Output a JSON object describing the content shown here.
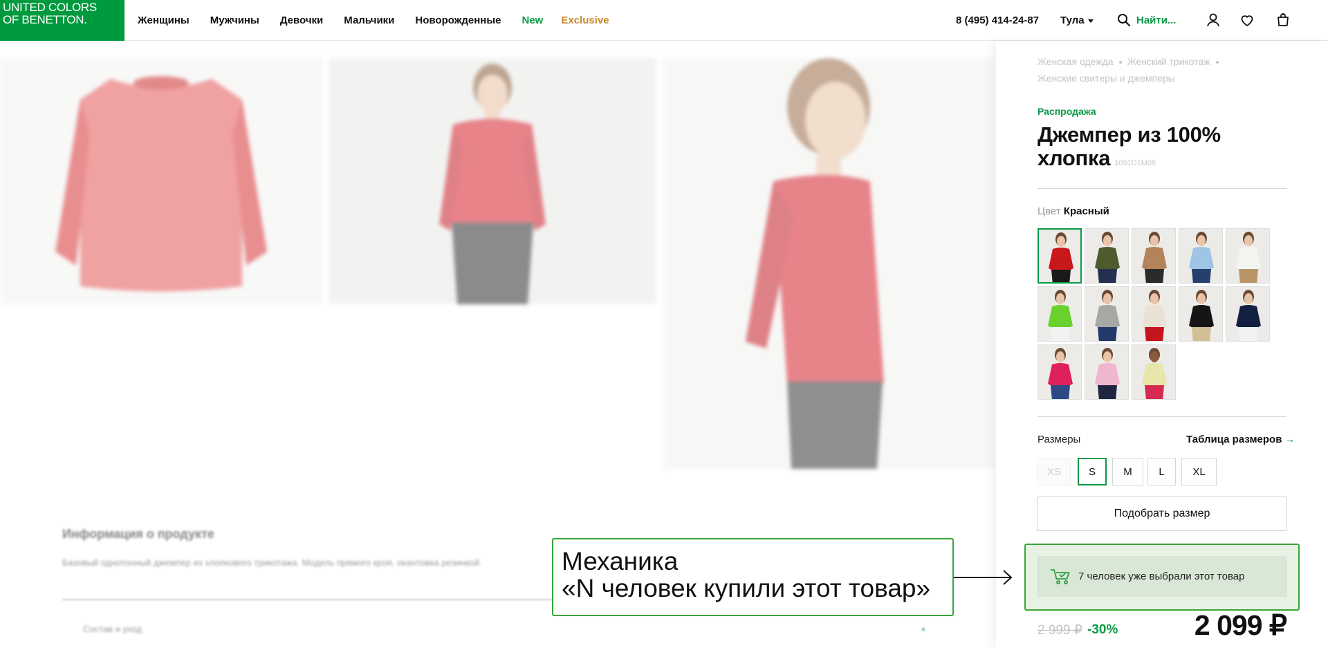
{
  "header": {
    "logo_line1": "UNITED COLORS",
    "logo_line2": "OF BENETTON.",
    "nav": [
      "Женщины",
      "Мужчины",
      "Девочки",
      "Мальчики",
      "Новорожденные",
      "New",
      "Exclusive"
    ],
    "phone": "8 (495) 414-24-87",
    "city": "Тула",
    "search_label": "Найти..."
  },
  "gallery": {
    "info_title": "Информация о продукте",
    "info_text": "Базовый однотонный джемпер из хлопкового трикотажа. Модель прямого кроя, окантовка резинкой.",
    "accordion_label": "Состав и уход"
  },
  "product": {
    "breadcrumbs": [
      "Женская одежда",
      "Женский трикотаж",
      "Женские свитеры и джемперы"
    ],
    "sale_label": "Распродажа",
    "title": "Джемпер из 100% хлопка",
    "sku": "1091D1M08",
    "color_label": "Цвет",
    "color_value": "Красный",
    "swatches": [
      {
        "top": "#c8181c",
        "bottom": "#1a1a1a",
        "skin": "#e9c4a8",
        "selected": true
      },
      {
        "top": "#4f5b2c",
        "bottom": "#24304f",
        "skin": "#e9c4a8"
      },
      {
        "top": "#b3835a",
        "bottom": "#2b2b2b",
        "skin": "#e9c4a8"
      },
      {
        "top": "#9ec4e6",
        "bottom": "#26406e",
        "skin": "#e9c4a8"
      },
      {
        "top": "#f4f4f2",
        "bottom": "#b99468",
        "skin": "#e9c4a8"
      },
      {
        "top": "#6ad12f",
        "bottom": "#f2f2f2",
        "skin": "#e9c4a8"
      },
      {
        "top": "#a5a8a4",
        "bottom": "#23396b",
        "skin": "#e9c4a8"
      },
      {
        "top": "#e9e2d4",
        "bottom": "#c4141c",
        "skin": "#e9c4a8"
      },
      {
        "top": "#151515",
        "bottom": "#d2bf96",
        "skin": "#e9c4a8"
      },
      {
        "top": "#142041",
        "bottom": "#f1f1f1",
        "skin": "#e9c4a8"
      },
      {
        "top": "#e0205a",
        "bottom": "#2c4a86",
        "skin": "#e9c4a8"
      },
      {
        "top": "#f0b6cf",
        "bottom": "#1e2540",
        "skin": "#e9c4a8"
      },
      {
        "top": "#e8e6ab",
        "bottom": "#d62a50",
        "skin": "#8a5a3c"
      }
    ],
    "sizes_label": "Размеры",
    "size_table_label": "Таблица размеров",
    "size_table_arrow": "→",
    "sizes": [
      {
        "label": "XS",
        "state": "disabled"
      },
      {
        "label": "S",
        "state": "selected"
      },
      {
        "label": "M",
        "state": "normal"
      },
      {
        "label": "L",
        "state": "normal"
      },
      {
        "label": "XL",
        "state": "normal"
      }
    ],
    "pick_size_label": "Подобрать размер",
    "old_price": "2 999 ₽",
    "discount": "-30%",
    "price": "2 099 ₽"
  },
  "annotation": {
    "badge_text": "7 человек уже выбрали этот товар",
    "callout_line1": "Механика",
    "callout_line2": "«N человек купили этот товар»"
  },
  "colors": {
    "brand_green": "#009a3e",
    "accent_green": "#0a9a46",
    "exclusive_gold": "#c88a2c",
    "annotation_green": "#36a636"
  }
}
